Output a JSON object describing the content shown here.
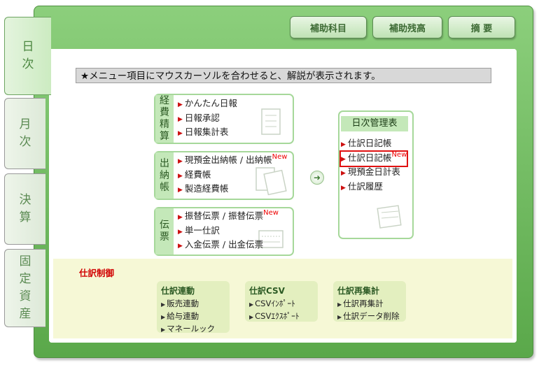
{
  "side_tabs": [
    {
      "chars": [
        "日",
        "次"
      ]
    },
    {
      "chars": [
        "月",
        "次"
      ]
    },
    {
      "chars": [
        "決",
        "算"
      ]
    },
    {
      "chars": [
        "固",
        "定",
        "資",
        "産"
      ]
    }
  ],
  "top_buttons": [
    "補助科目",
    "補助残高",
    "摘 要"
  ],
  "info_text": "★メニュー項目にマウスカーソルを合わせると、解説が表示されます。",
  "cards": [
    {
      "label_chars": [
        "経",
        "費",
        "精",
        "算"
      ],
      "items": [
        "かんたん日報",
        "日報承認",
        "日報集計表"
      ]
    },
    {
      "label_chars": [
        "出",
        "納",
        "帳"
      ],
      "items": [
        "現預金出納帳 / 出納帳",
        "経費帳",
        "製造経費帳"
      ],
      "new_on": 0
    },
    {
      "label_chars": [
        "伝",
        "票"
      ],
      "items": [
        "振替伝票 / 振替伝票",
        "単一仕訳",
        "入金伝票 / 出金伝票"
      ],
      "new_on": 0
    }
  ],
  "new_label": "New",
  "arrow_glyph": "➜",
  "nichiji": {
    "title": "日次管理表",
    "items": [
      "仕訳日記帳",
      "仕訳日記帳",
      "現預金日計表",
      "仕訳履歴"
    ],
    "new_on": 1
  },
  "shiwake": {
    "title": "仕訳制御",
    "groups": [
      {
        "title": "仕訳連動",
        "items": [
          "販売連動",
          "給与連動",
          "マネールック"
        ]
      },
      {
        "title": "仕訳CSV",
        "items": [
          "CSVｲﾝﾎﾟｰﾄ",
          "CSVｴｸｽﾎﾟｰﾄ"
        ]
      },
      {
        "title": "仕訳再集計",
        "items": [
          "仕訳再集計",
          "仕訳データ削除"
        ]
      }
    ]
  },
  "colors": {
    "accent_red": "#cc1111",
    "green_dark": "#4e8f40",
    "label_bg": "#c4e8b9"
  }
}
